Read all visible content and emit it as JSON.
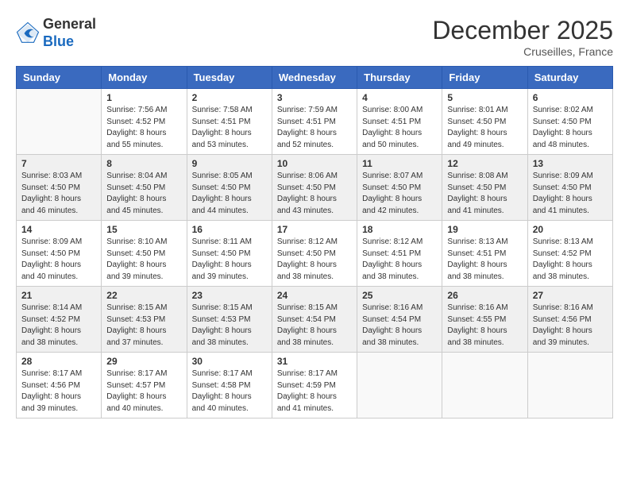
{
  "logo": {
    "general": "General",
    "blue": "Blue"
  },
  "header": {
    "month": "December 2025",
    "location": "Cruseilles, France"
  },
  "weekdays": [
    "Sunday",
    "Monday",
    "Tuesday",
    "Wednesday",
    "Thursday",
    "Friday",
    "Saturday"
  ],
  "weeks": [
    [
      {
        "day": "",
        "info": ""
      },
      {
        "day": "1",
        "info": "Sunrise: 7:56 AM\nSunset: 4:52 PM\nDaylight: 8 hours\nand 55 minutes."
      },
      {
        "day": "2",
        "info": "Sunrise: 7:58 AM\nSunset: 4:51 PM\nDaylight: 8 hours\nand 53 minutes."
      },
      {
        "day": "3",
        "info": "Sunrise: 7:59 AM\nSunset: 4:51 PM\nDaylight: 8 hours\nand 52 minutes."
      },
      {
        "day": "4",
        "info": "Sunrise: 8:00 AM\nSunset: 4:51 PM\nDaylight: 8 hours\nand 50 minutes."
      },
      {
        "day": "5",
        "info": "Sunrise: 8:01 AM\nSunset: 4:50 PM\nDaylight: 8 hours\nand 49 minutes."
      },
      {
        "day": "6",
        "info": "Sunrise: 8:02 AM\nSunset: 4:50 PM\nDaylight: 8 hours\nand 48 minutes."
      }
    ],
    [
      {
        "day": "7",
        "info": "Sunrise: 8:03 AM\nSunset: 4:50 PM\nDaylight: 8 hours\nand 46 minutes."
      },
      {
        "day": "8",
        "info": "Sunrise: 8:04 AM\nSunset: 4:50 PM\nDaylight: 8 hours\nand 45 minutes."
      },
      {
        "day": "9",
        "info": "Sunrise: 8:05 AM\nSunset: 4:50 PM\nDaylight: 8 hours\nand 44 minutes."
      },
      {
        "day": "10",
        "info": "Sunrise: 8:06 AM\nSunset: 4:50 PM\nDaylight: 8 hours\nand 43 minutes."
      },
      {
        "day": "11",
        "info": "Sunrise: 8:07 AM\nSunset: 4:50 PM\nDaylight: 8 hours\nand 42 minutes."
      },
      {
        "day": "12",
        "info": "Sunrise: 8:08 AM\nSunset: 4:50 PM\nDaylight: 8 hours\nand 41 minutes."
      },
      {
        "day": "13",
        "info": "Sunrise: 8:09 AM\nSunset: 4:50 PM\nDaylight: 8 hours\nand 41 minutes."
      }
    ],
    [
      {
        "day": "14",
        "info": "Sunrise: 8:09 AM\nSunset: 4:50 PM\nDaylight: 8 hours\nand 40 minutes."
      },
      {
        "day": "15",
        "info": "Sunrise: 8:10 AM\nSunset: 4:50 PM\nDaylight: 8 hours\nand 39 minutes."
      },
      {
        "day": "16",
        "info": "Sunrise: 8:11 AM\nSunset: 4:50 PM\nDaylight: 8 hours\nand 39 minutes."
      },
      {
        "day": "17",
        "info": "Sunrise: 8:12 AM\nSunset: 4:50 PM\nDaylight: 8 hours\nand 38 minutes."
      },
      {
        "day": "18",
        "info": "Sunrise: 8:12 AM\nSunset: 4:51 PM\nDaylight: 8 hours\nand 38 minutes."
      },
      {
        "day": "19",
        "info": "Sunrise: 8:13 AM\nSunset: 4:51 PM\nDaylight: 8 hours\nand 38 minutes."
      },
      {
        "day": "20",
        "info": "Sunrise: 8:13 AM\nSunset: 4:52 PM\nDaylight: 8 hours\nand 38 minutes."
      }
    ],
    [
      {
        "day": "21",
        "info": "Sunrise: 8:14 AM\nSunset: 4:52 PM\nDaylight: 8 hours\nand 38 minutes."
      },
      {
        "day": "22",
        "info": "Sunrise: 8:15 AM\nSunset: 4:53 PM\nDaylight: 8 hours\nand 37 minutes."
      },
      {
        "day": "23",
        "info": "Sunrise: 8:15 AM\nSunset: 4:53 PM\nDaylight: 8 hours\nand 38 minutes."
      },
      {
        "day": "24",
        "info": "Sunrise: 8:15 AM\nSunset: 4:54 PM\nDaylight: 8 hours\nand 38 minutes."
      },
      {
        "day": "25",
        "info": "Sunrise: 8:16 AM\nSunset: 4:54 PM\nDaylight: 8 hours\nand 38 minutes."
      },
      {
        "day": "26",
        "info": "Sunrise: 8:16 AM\nSunset: 4:55 PM\nDaylight: 8 hours\nand 38 minutes."
      },
      {
        "day": "27",
        "info": "Sunrise: 8:16 AM\nSunset: 4:56 PM\nDaylight: 8 hours\nand 39 minutes."
      }
    ],
    [
      {
        "day": "28",
        "info": "Sunrise: 8:17 AM\nSunset: 4:56 PM\nDaylight: 8 hours\nand 39 minutes."
      },
      {
        "day": "29",
        "info": "Sunrise: 8:17 AM\nSunset: 4:57 PM\nDaylight: 8 hours\nand 40 minutes."
      },
      {
        "day": "30",
        "info": "Sunrise: 8:17 AM\nSunset: 4:58 PM\nDaylight: 8 hours\nand 40 minutes."
      },
      {
        "day": "31",
        "info": "Sunrise: 8:17 AM\nSunset: 4:59 PM\nDaylight: 8 hours\nand 41 minutes."
      },
      {
        "day": "",
        "info": ""
      },
      {
        "day": "",
        "info": ""
      },
      {
        "day": "",
        "info": ""
      }
    ]
  ]
}
